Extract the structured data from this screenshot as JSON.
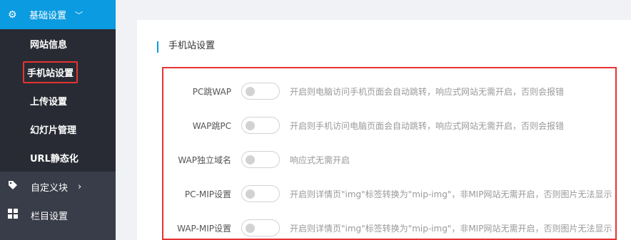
{
  "sidebar": {
    "section": {
      "label": "基础设置",
      "icon": "gear-icon",
      "chevron": "chevron-down-icon"
    },
    "sub_items": [
      {
        "label": "网站信息"
      },
      {
        "label": "手机站设置",
        "active": true
      },
      {
        "label": "上传设置"
      },
      {
        "label": "幻灯片管理"
      },
      {
        "label": "URL静态化"
      }
    ],
    "menu": [
      {
        "label": "自定义块",
        "icon": "tag-icon",
        "chevron": "chevron-right-icon"
      },
      {
        "label": "栏目设置",
        "icon": "grid-icon"
      }
    ]
  },
  "main": {
    "title": "手机站设置",
    "settings": [
      {
        "label": "PC跳WAP",
        "enabled": false,
        "hint": "开启则电脑访问手机页面会自动跳转，响应式网站无需开启，否则会报错"
      },
      {
        "label": "WAP跳PC",
        "enabled": false,
        "hint": "开启则手机访问电脑页面会自动跳转，响应式网站无需开启，否则会报错"
      },
      {
        "label": "WAP独立域名",
        "enabled": false,
        "hint": "响应式无需开启"
      },
      {
        "label": "PC-MIP设置",
        "enabled": false,
        "hint": "开启则详情页\"img\"标签转换为\"mip-img\"，非MIP网站无需开启，否则图片无法显示"
      },
      {
        "label": "WAP-MIP设置",
        "enabled": false,
        "hint": "开启则详情页\"img\"标签转换为\"mip-img\"，非MIP网站无需开启，否则图片无法显示"
      }
    ]
  },
  "colors": {
    "accent": "#0b9be0",
    "sidebar_bg": "#393d49",
    "submenu_bg": "#282b33",
    "highlight": "#e53333"
  }
}
